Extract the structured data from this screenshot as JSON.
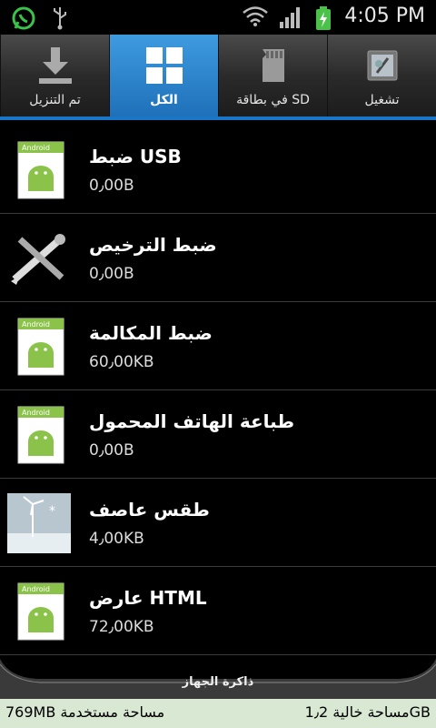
{
  "status_bar": {
    "time": "4:05 PM"
  },
  "tabs": [
    {
      "label": "الكل",
      "icon": "grid-icon",
      "active": true
    },
    {
      "label": "تم التنزيل",
      "icon": "download-icon",
      "active": false
    },
    {
      "label": "في بطاقة SD",
      "icon": "sd-card-icon",
      "active": false
    },
    {
      "label": "تشغيل",
      "icon": "running-icon",
      "active": false
    }
  ],
  "apps": [
    {
      "name": "ضبط USB",
      "size": "0٫00B",
      "icon": "android-app-icon"
    },
    {
      "name": "ضبط الترخيص",
      "size": "0٫00B",
      "icon": "license-tools-icon"
    },
    {
      "name": "ضبط المكالمة",
      "size": "60٫00KB",
      "icon": "android-app-icon"
    },
    {
      "name": "طباعة الهاتف المحمول",
      "size": "0٫00B",
      "icon": "android-app-icon"
    },
    {
      "name": "طقس عاصف",
      "size": "4٫00KB",
      "icon": "weather-wallpaper-icon"
    },
    {
      "name": "عارض HTML",
      "size": "72٫00KB",
      "icon": "android-app-icon"
    }
  ],
  "footer": {
    "section_label": "ذاكرة الجهاز",
    "used": "769MB مساحة مستخدمة",
    "free": "مساحة خالية 1٫2GB"
  },
  "colors": {
    "accent": "#1d6fb8",
    "storage_bar": "#d8e8d2"
  }
}
